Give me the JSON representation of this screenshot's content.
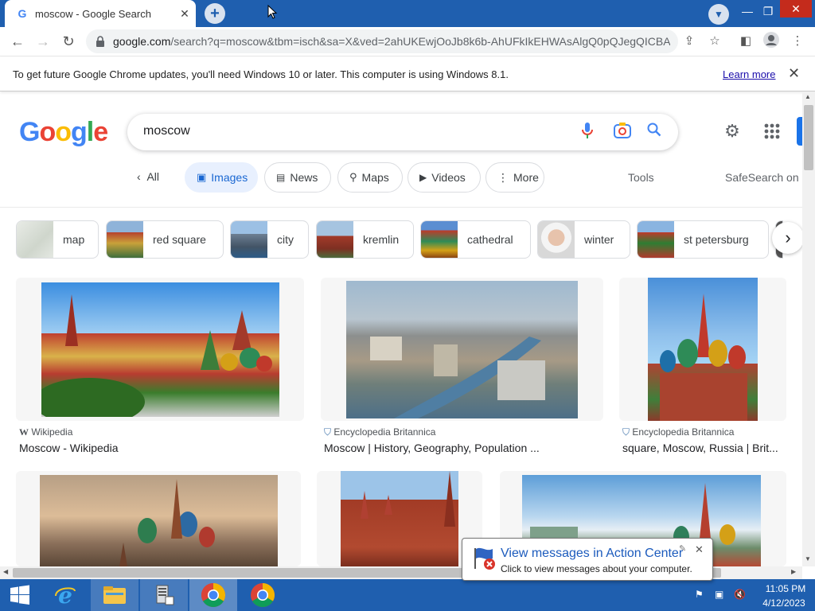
{
  "browser": {
    "tab_title": "moscow - Google Search",
    "tab_favicon": "G",
    "url_host": "google.com",
    "url_rest": "/search?q=moscow&tbm=isch&sa=X&ved=2ahUKEwjOoJb8k6b-AhUFkIkEHWAsAlgQ0pQJegQICBA...",
    "infobar_text": "To get future Google Chrome updates, you'll need Windows 10 or later. This computer is using Windows 8.1.",
    "infobar_link": "Learn more"
  },
  "google": {
    "logo_letters": [
      "G",
      "o",
      "o",
      "g",
      "l",
      "e"
    ],
    "logo_colors": [
      "#4285f4",
      "#ea4335",
      "#fbbc05",
      "#4285f4",
      "#34a853",
      "#ea4335"
    ],
    "query": "moscow",
    "nav": {
      "all": "All",
      "images": "Images",
      "news": "News",
      "maps": "Maps",
      "videos": "Videos",
      "more": "More",
      "tools": "Tools",
      "safesearch": "SafeSearch on"
    },
    "suggestions": [
      "map",
      "red square",
      "city",
      "kremlin",
      "cathedral",
      "winter",
      "st petersburg"
    ],
    "results": [
      {
        "source": "Wikipedia",
        "title": "Moscow - Wikipedia"
      },
      {
        "source": "Encyclopedia Britannica",
        "title": "Moscow | History, Geography, Population ..."
      },
      {
        "source": "Encyclopedia Britannica",
        "title": "square, Moscow, Russia | Brit..."
      }
    ]
  },
  "notification": {
    "title": "View messages in Action Center",
    "body": "Click to view messages about your computer."
  },
  "taskbar": {
    "time": "11:05 PM",
    "date": "4/12/2023"
  },
  "colors": {
    "titlebar": "#1f5faf",
    "accent": "#1a73e8"
  }
}
